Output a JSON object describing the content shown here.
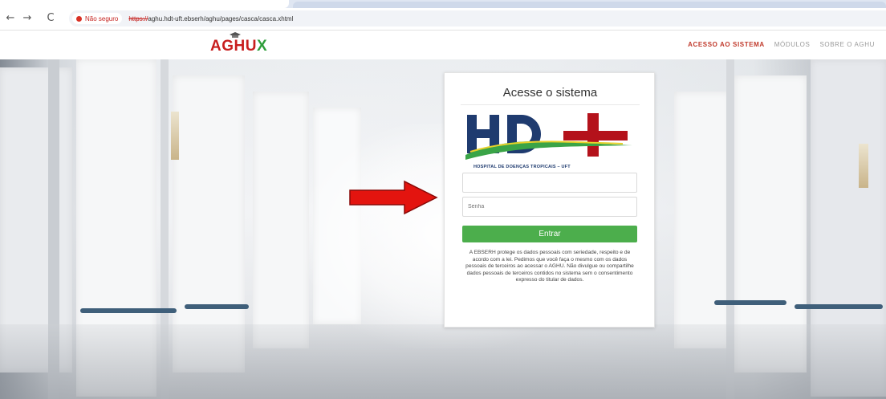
{
  "browser": {
    "nav": {
      "back": "←",
      "forward": "→",
      "reload": "C"
    },
    "security_label": "Não seguro",
    "url_scheme": "https://",
    "url_rest": "aghu.hdt-uft.ebserh/aghu/pages/casca/casca.xhtml"
  },
  "site": {
    "logo_main": "AGHU",
    "logo_x": "X",
    "nav": [
      {
        "label": "ACESSO AO SISTEMA",
        "active": true
      },
      {
        "label": "MÓDULOS",
        "active": false
      },
      {
        "label": "SOBRE O AGHU",
        "active": false
      }
    ]
  },
  "login": {
    "title": "Acesse o sistema",
    "hospital_logo_caption": "HOSPITAL DE DOENÇAS TROPICAIS – UFT",
    "username_value": "",
    "username_placeholder": "",
    "password_placeholder": "Senha",
    "submit_label": "Entrar",
    "privacy_notice": "A EBSERH protege os dados pessoais com seriedade, respeito e de acordo com a lei. Pedimos que você faça o mesmo com os dados pessoais de terceiros ao acessar o AGHU. Não divulgue ou compartilhe dados pessoais de terceiros contidos no sistema sem o consentimento expresso do titular de dados."
  },
  "colors": {
    "brand_red": "#c81e1e",
    "brand_green": "#2e9d3a",
    "button_green": "#4cae4c",
    "hdt_blue": "#1f3b6f",
    "annotation_arrow": "#e3140f"
  },
  "icons": {
    "arrow": "red-arrow-pointer-icon",
    "security": "not-secure-icon"
  }
}
